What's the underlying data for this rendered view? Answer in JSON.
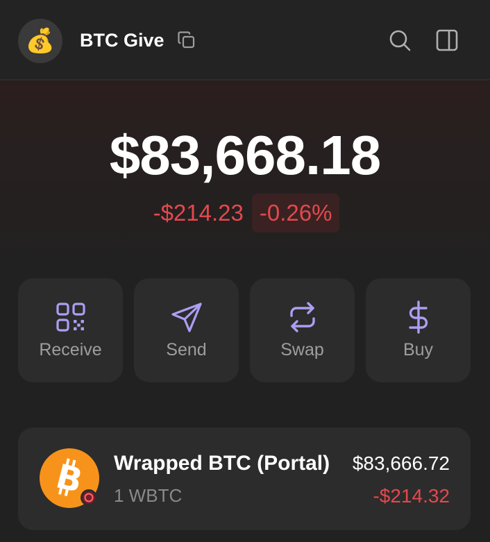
{
  "header": {
    "wallet_emoji": "💰",
    "wallet_name": "BTC Give",
    "icons": [
      "copy-icon",
      "search-icon",
      "sidebar-panel-icon"
    ]
  },
  "balance": {
    "total": "$83,668.18",
    "change_amount": "-$214.23",
    "change_percent": "-0.26%"
  },
  "actions": [
    {
      "label": "Receive",
      "icon": "qr-code-icon"
    },
    {
      "label": "Send",
      "icon": "send-icon"
    },
    {
      "label": "Swap",
      "icon": "swap-icon"
    },
    {
      "label": "Buy",
      "icon": "dollar-icon"
    }
  ],
  "tokens": [
    {
      "name": "Wrapped BTC (Portal)",
      "amount": "1 WBTC",
      "value": "$83,666.72",
      "change": "-$214.32",
      "icon": "bitcoin-icon"
    }
  ],
  "colors": {
    "background": "#212121",
    "card": "#2c2c2c",
    "accent": "#ab9ff2",
    "negative": "#e5484d",
    "bitcoin": "#f7931a"
  }
}
